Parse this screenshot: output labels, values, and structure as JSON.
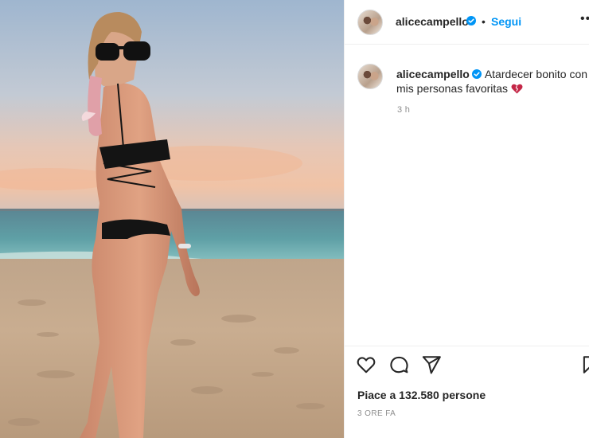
{
  "post": {
    "username": "alicecampello",
    "verified": true,
    "follow_label": "Segui",
    "more_label": "••",
    "separator": "•"
  },
  "caption": {
    "username": "alicecampello",
    "text": "Atardecer bonito con mis personas favoritas",
    "emoji": "heart-emoji",
    "time": "3 h"
  },
  "engagement": {
    "likes_label": "Piace a 132.580 persone",
    "time_label": "3 ORE FA"
  },
  "colors": {
    "accent": "#0095f6",
    "heart": "#c42747",
    "text": "#262626",
    "muted": "#8e8e8e"
  }
}
